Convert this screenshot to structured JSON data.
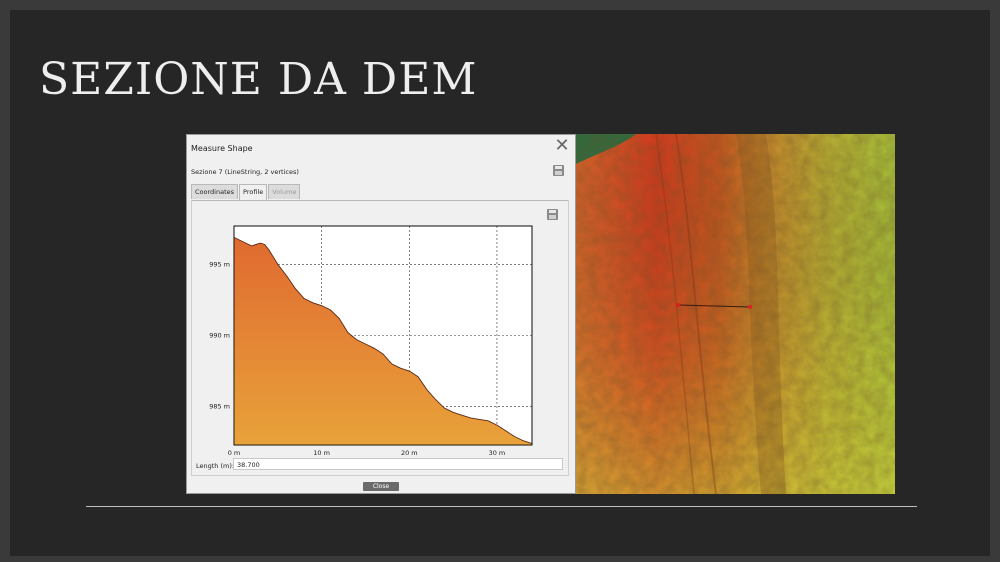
{
  "slide": {
    "title": "SEZIONE DA DEM"
  },
  "dialog": {
    "title": "Measure Shape",
    "close_icon": "close-icon",
    "subtitle": "Sezione 7 (LineString, 2 vertices)",
    "tabs": [
      {
        "label": "Coordinates",
        "state": "normal"
      },
      {
        "label": "Profile",
        "state": "active"
      },
      {
        "label": "Volume",
        "state": "disabled"
      }
    ],
    "length_label": "Length (m):",
    "length_value": "38.700",
    "close_label": "Close"
  },
  "chart_data": {
    "type": "area",
    "xlabel": "",
    "ylabel": "",
    "x_ticks": [
      "0 m",
      "10 m",
      "20 m",
      "30 m"
    ],
    "x_tick_values": [
      0,
      10,
      20,
      30
    ],
    "y_ticks": [
      "995 m",
      "990 m",
      "985 m"
    ],
    "y_tick_values": [
      995,
      990,
      985
    ],
    "xlim": [
      0,
      34
    ],
    "ylim": [
      982.3,
      997.7
    ],
    "grid": true,
    "fill_color_top": "#e06a30",
    "fill_color_bottom": "#e8a23a",
    "x": [
      0,
      1,
      2,
      3,
      3.5,
      4,
      5,
      6,
      7,
      8,
      9,
      10,
      11,
      12,
      13,
      14,
      15,
      16,
      17,
      18,
      19,
      20,
      21,
      22,
      23,
      24,
      25,
      26,
      27,
      28,
      29,
      30,
      31,
      32,
      33,
      34
    ],
    "values": [
      996.9,
      996.6,
      996.3,
      996.5,
      996.4,
      996.0,
      995.0,
      994.2,
      993.3,
      992.6,
      992.3,
      992.1,
      991.8,
      991.2,
      990.2,
      989.7,
      989.4,
      989.1,
      988.7,
      988.0,
      987.7,
      987.5,
      987.1,
      986.2,
      985.5,
      984.9,
      984.6,
      984.4,
      984.2,
      984.1,
      984.0,
      983.7,
      983.3,
      982.9,
      982.6,
      982.4
    ]
  }
}
